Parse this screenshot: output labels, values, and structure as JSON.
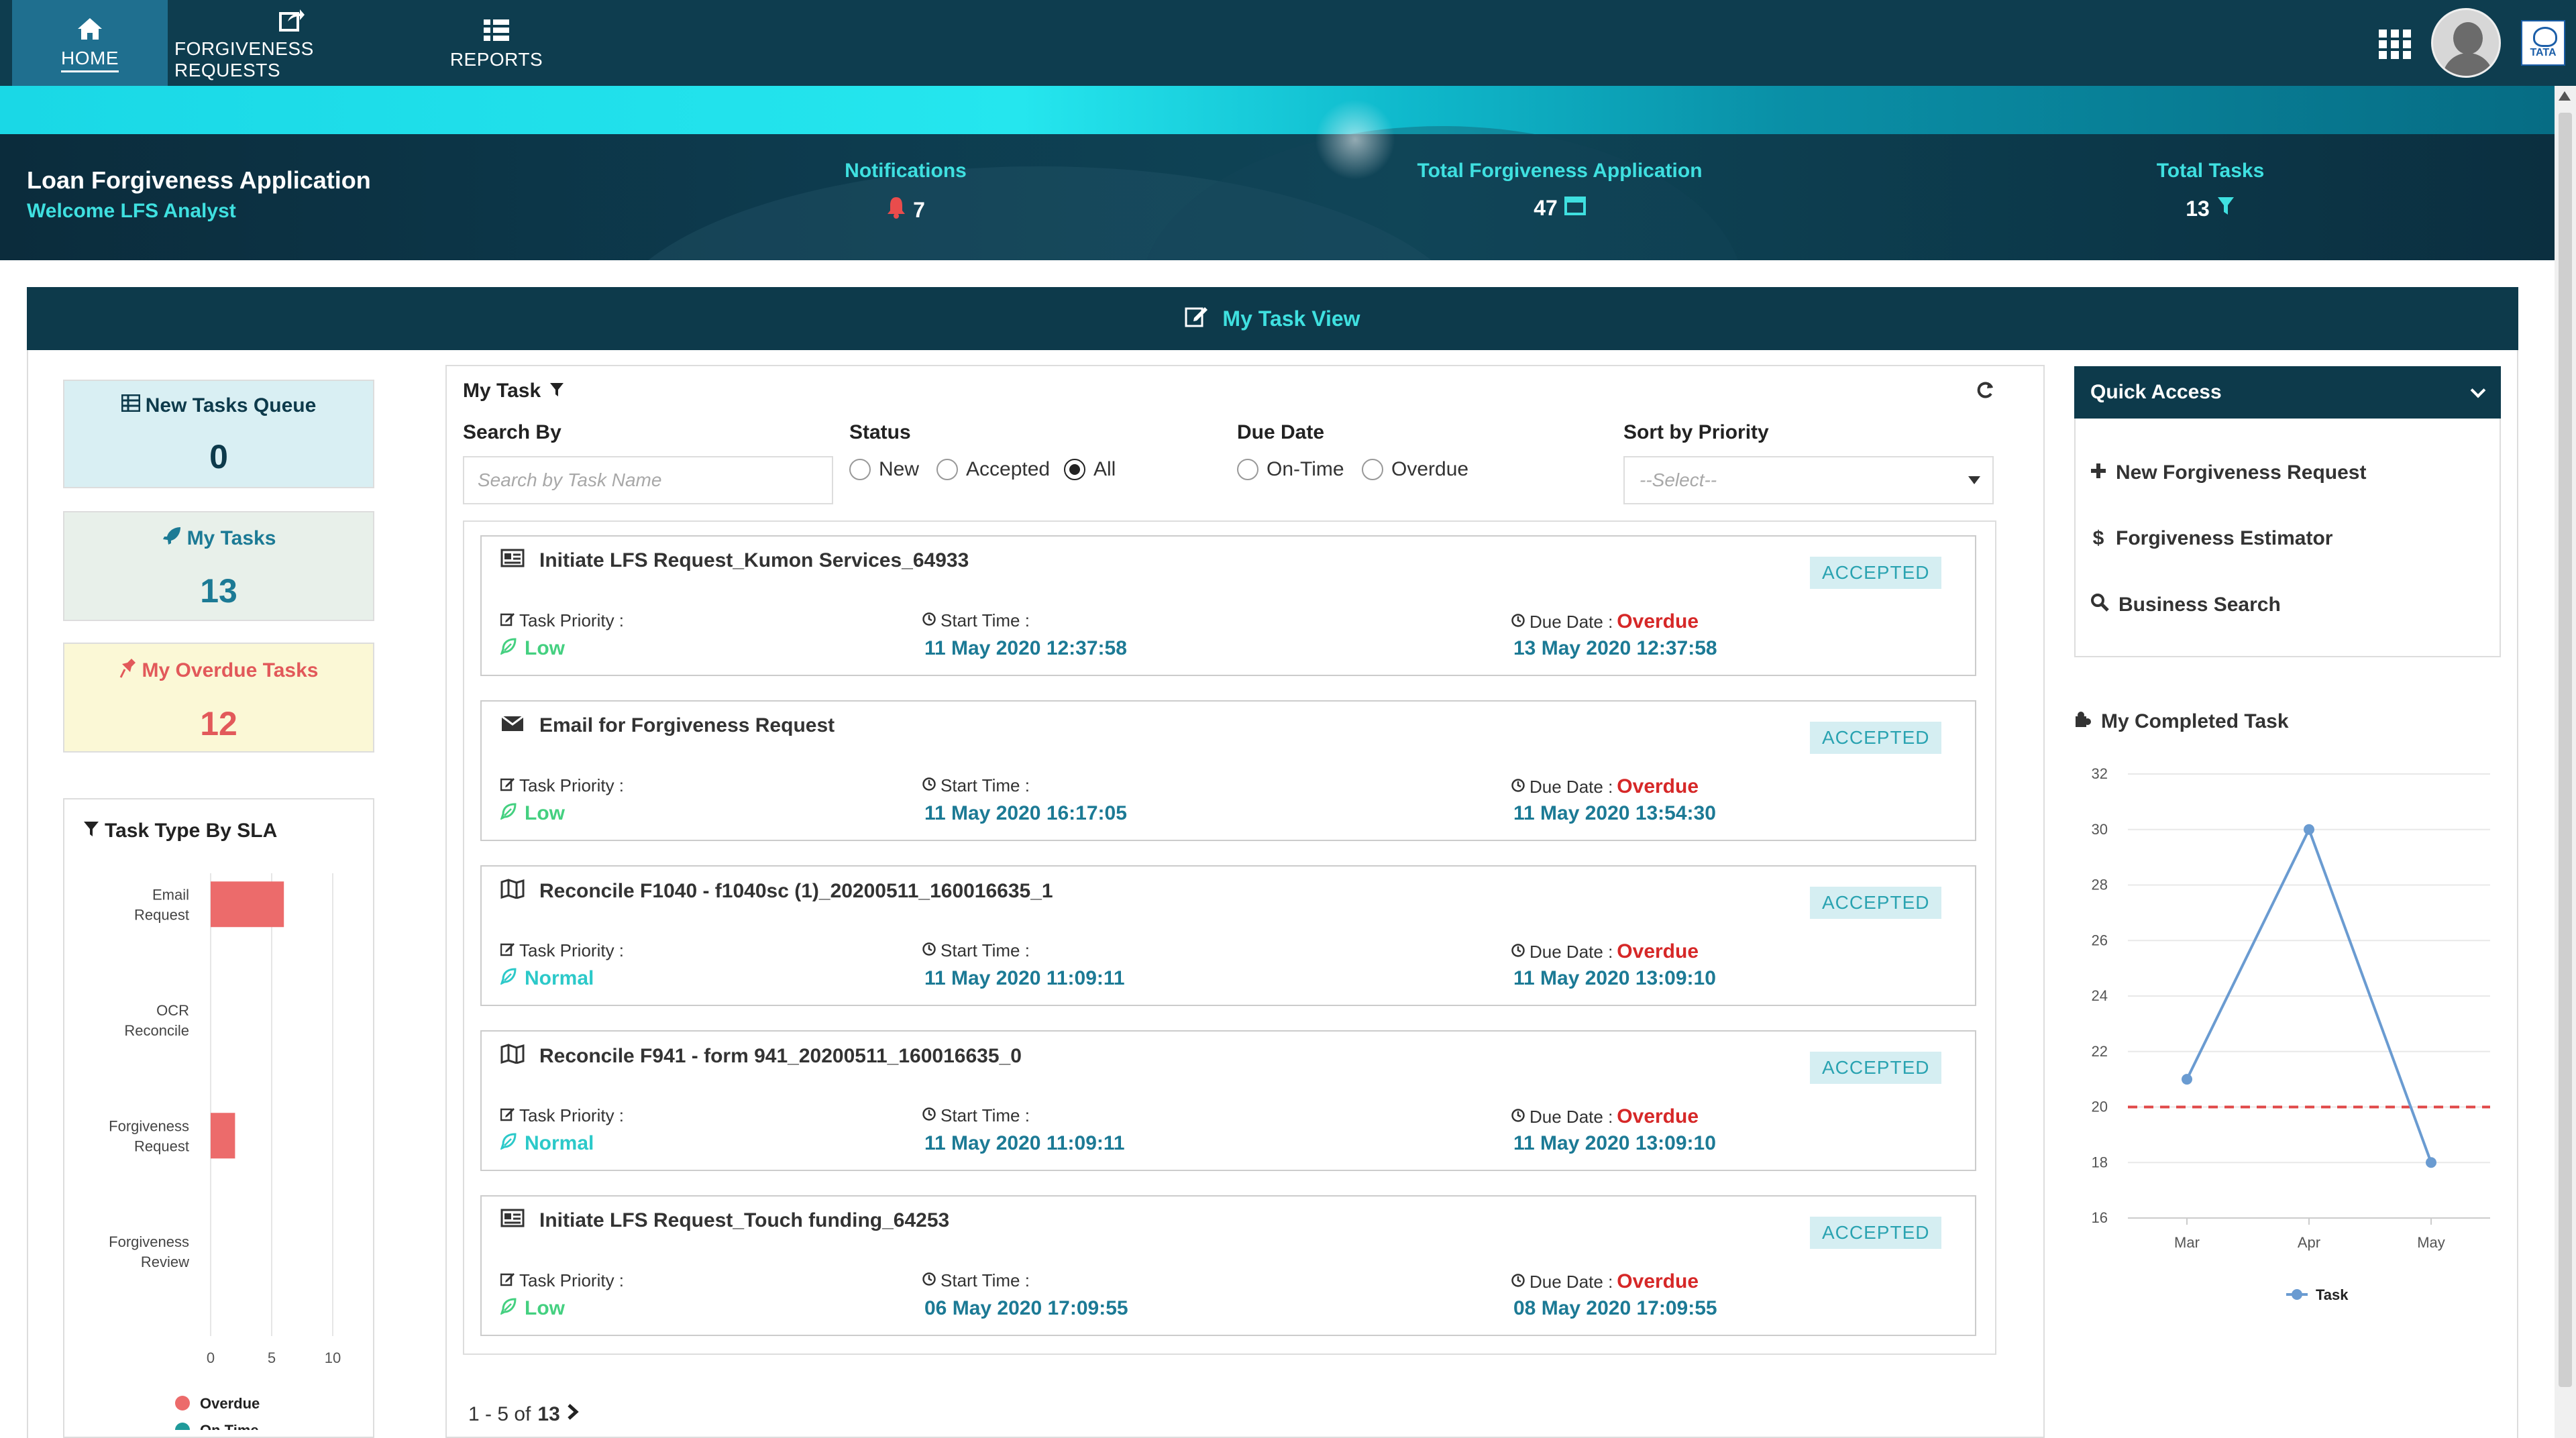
{
  "nav": {
    "items": [
      {
        "label": "HOME",
        "icon": "home-icon"
      },
      {
        "label": "FORGIVENESS REQUESTS",
        "icon": "share-icon"
      },
      {
        "label": "REPORTS",
        "icon": "list-icon"
      }
    ],
    "brand_logo_text": "TATA"
  },
  "banner": {
    "title": "Loan Forgiveness Application",
    "welcome": "Welcome LFS Analyst",
    "stats": [
      {
        "label": "Notifications",
        "value": "7",
        "icon": "bell-icon"
      },
      {
        "label": "Total Forgiveness Application",
        "value": "47",
        "icon": "window-icon"
      },
      {
        "label": "Total Tasks",
        "value": "13",
        "icon": "filter-icon"
      }
    ]
  },
  "task_view": {
    "title": "My Task View"
  },
  "cards": {
    "new_queue": {
      "label": "New Tasks Queue",
      "value": "0"
    },
    "my_tasks": {
      "label": "My Tasks",
      "value": "13"
    },
    "overdue": {
      "label": "My Overdue Tasks",
      "value": "12"
    }
  },
  "sla": {
    "title": "Task Type By SLA"
  },
  "filters": {
    "title": "My Task",
    "search_by": "Search By",
    "search_placeholder": "Search by Task Name",
    "status_label": "Status",
    "status_options": [
      "New",
      "Accepted",
      "All"
    ],
    "status_selected": "All",
    "due_label": "Due Date",
    "due_options": [
      "On-Time",
      "Overdue"
    ],
    "sort_label": "Sort by Priority",
    "sort_value": "--Select--"
  },
  "labels": {
    "priority": "Task Priority :",
    "start": "Start Time :",
    "due": "Due Date :"
  },
  "tasks": [
    {
      "title": "Initiate LFS Request_Kumon Services_64933",
      "status": "ACCEPTED",
      "priority": "Low",
      "start": "11 May 2020 12:37:58",
      "due_status": "Overdue",
      "due": "13 May 2020 12:37:58",
      "icon": "id-card-icon"
    },
    {
      "title": "Email for Forgiveness Request",
      "status": "ACCEPTED",
      "priority": "Low",
      "start": "11 May 2020 16:17:05",
      "due_status": "Overdue",
      "due": "11 May 2020 13:54:30",
      "icon": "envelope-icon"
    },
    {
      "title": "Reconcile  F1040 - f1040sc (1)_20200511_160016635_1",
      "status": "ACCEPTED",
      "priority": "Normal",
      "start": "11 May 2020 11:09:11",
      "due_status": "Overdue",
      "due": "11 May 2020 13:09:10",
      "icon": "map-icon"
    },
    {
      "title": "Reconcile  F941 - form 941_20200511_160016635_0",
      "status": "ACCEPTED",
      "priority": "Normal",
      "start": "11 May 2020 11:09:11",
      "due_status": "Overdue",
      "due": "11 May 2020 13:09:10",
      "icon": "map-icon"
    },
    {
      "title": "Initiate LFS Request_Touch funding_64253",
      "status": "ACCEPTED",
      "priority": "Low",
      "start": "06 May 2020 17:09:55",
      "due_status": "Overdue",
      "due": "08 May 2020 17:09:55",
      "icon": "id-card-icon"
    }
  ],
  "pager": {
    "range": "1 - 5 of",
    "total": "13"
  },
  "quick_access": {
    "title": "Quick Access",
    "items": [
      {
        "label": "New Forgiveness Request",
        "icon": "plus-icon"
      },
      {
        "label": "Forgiveness Estimator",
        "icon": "dollar-icon"
      },
      {
        "label": "Business Search",
        "icon": "search-icon"
      }
    ]
  },
  "completed": {
    "title": "My Completed Task"
  },
  "colors": {
    "overdue": "#ec6b6b",
    "ontime": "#1f9a9a",
    "task_line": "#6a9bd1",
    "threshold": "#e04848"
  },
  "chart_data": [
    {
      "type": "bar",
      "orientation": "horizontal",
      "title": "Task Type By SLA",
      "categories": [
        "Email Request",
        "OCR Reconcile",
        "Forgiveness Request",
        "Forgiveness Review"
      ],
      "series": [
        {
          "name": "Overdue",
          "values": [
            6,
            0,
            2,
            0
          ]
        },
        {
          "name": "On Time",
          "values": [
            0,
            0,
            0,
            0
          ]
        }
      ],
      "xticks": [
        "0",
        "5",
        "10"
      ],
      "xlim": [
        0,
        10
      ],
      "grid": true,
      "legend": "bottom"
    },
    {
      "type": "line",
      "title": "My Completed Task",
      "categories": [
        "Mar",
        "Apr",
        "May"
      ],
      "series": [
        {
          "name": "Task",
          "values": [
            21,
            30,
            18
          ]
        }
      ],
      "threshold": 20,
      "yticks": [
        "16",
        "18",
        "20",
        "22",
        "24",
        "26",
        "28",
        "30",
        "32"
      ],
      "ylim": [
        16,
        32
      ],
      "grid": true,
      "legend": "bottom"
    }
  ]
}
